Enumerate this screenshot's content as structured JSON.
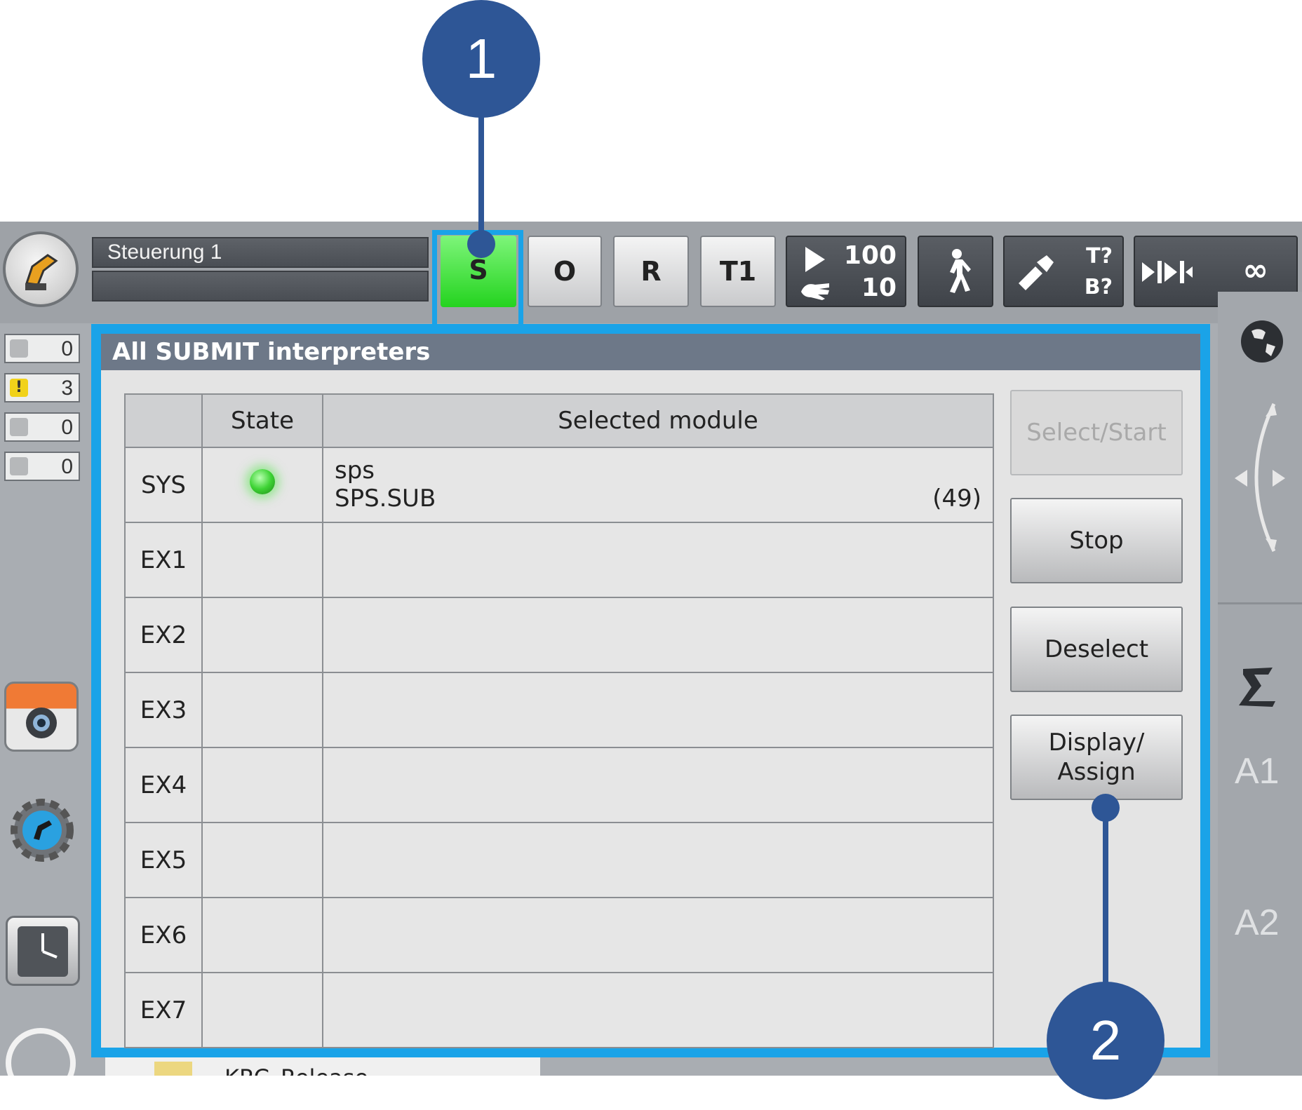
{
  "header": {
    "controller_name": "Steuerung 1",
    "submit_status": "S",
    "robot_interpreter_status": "O",
    "drives_status": "R",
    "mode": "T1",
    "override_program": "100",
    "override_jog": "10",
    "tool_status_top": "T?",
    "tool_status_bottom": "B?",
    "run_mode": "∞"
  },
  "messages": {
    "acknowledge": "0",
    "warning": "3",
    "info": "0",
    "wait": "0"
  },
  "dialog": {
    "title": "All SUBMIT interpreters",
    "columns": [
      "",
      "State",
      "Selected module"
    ],
    "rows": [
      {
        "id": "SYS",
        "module_line1": "sps",
        "module_line2": "SPS.SUB",
        "module_line_num": "(49)"
      },
      {
        "id": "EX1",
        "module_line1": "",
        "module_line2": "",
        "module_line_num": ""
      },
      {
        "id": "EX2",
        "module_line1": "",
        "module_line2": "",
        "module_line_num": ""
      },
      {
        "id": "EX3",
        "module_line1": "",
        "module_line2": "",
        "module_line_num": ""
      },
      {
        "id": "EX4",
        "module_line1": "",
        "module_line2": "",
        "module_line_num": ""
      },
      {
        "id": "EX5",
        "module_line1": "",
        "module_line2": "",
        "module_line_num": ""
      },
      {
        "id": "EX6",
        "module_line1": "",
        "module_line2": "",
        "module_line_num": ""
      },
      {
        "id": "EX7",
        "module_line1": "",
        "module_line2": "",
        "module_line_num": ""
      }
    ],
    "buttons": {
      "select_start": "Select/Start",
      "stop": "Stop",
      "deselect": "Deselect",
      "display_assign_1": "Display/",
      "display_assign_2": "Assign"
    }
  },
  "right_panel": {
    "axis1": "A1",
    "axis2": "A2"
  },
  "background_tree_item": "KRC_Release",
  "callouts": {
    "first": "1",
    "second": "2"
  },
  "colors": {
    "highlight": "#1aa3e8",
    "callout": "#2e5696",
    "submit_green": "#24d31f",
    "dialog_title_bg": "#6d7888"
  }
}
